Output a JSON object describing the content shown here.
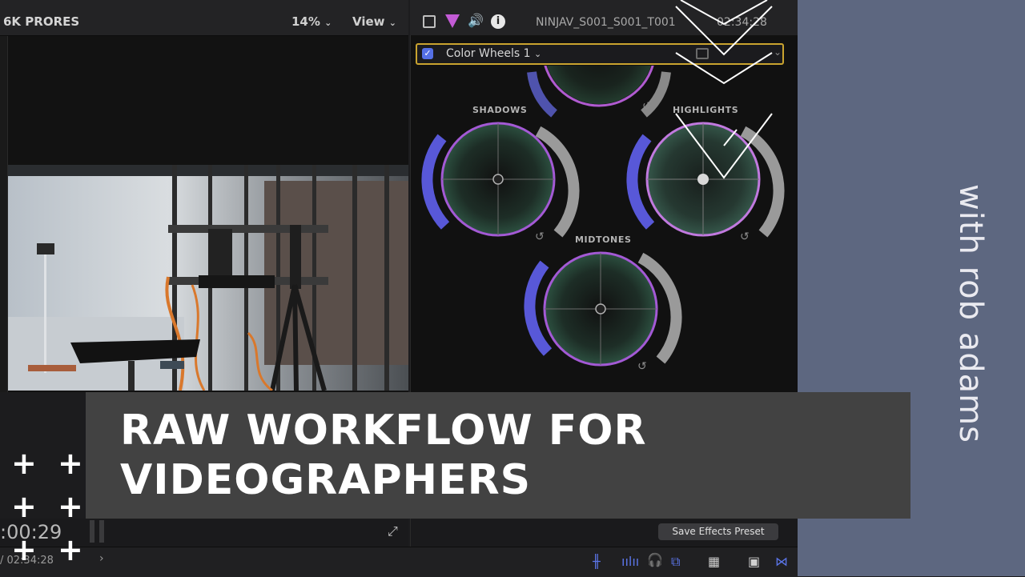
{
  "viewer": {
    "format_label": "6K PRORES",
    "zoom": "14%",
    "view_menu": "View",
    "playhead_timecode": ":00:29",
    "duration": "/ 02:34:28"
  },
  "inspector": {
    "clip_name": "NINJAV_S001_S001_T001",
    "timecode": "02:34:28",
    "effect_name": "Color Wheels 1",
    "wheels": {
      "shadows": "SHADOWS",
      "highlights": "HIGHLIGHTS",
      "midtones": "MIDTONES"
    },
    "save_preset_label": "Save Effects Preset"
  },
  "branding": {
    "title_line_1": "RAW WORKFLOW FOR",
    "title_line_2": "VIDEOGRAPHERS",
    "byline": "with rob adams"
  },
  "colors": {
    "side_panel": "#5d6780",
    "title_banner": "#424242",
    "effect_highlight": "#c9a32f",
    "accent_blue": "#5570e6"
  }
}
